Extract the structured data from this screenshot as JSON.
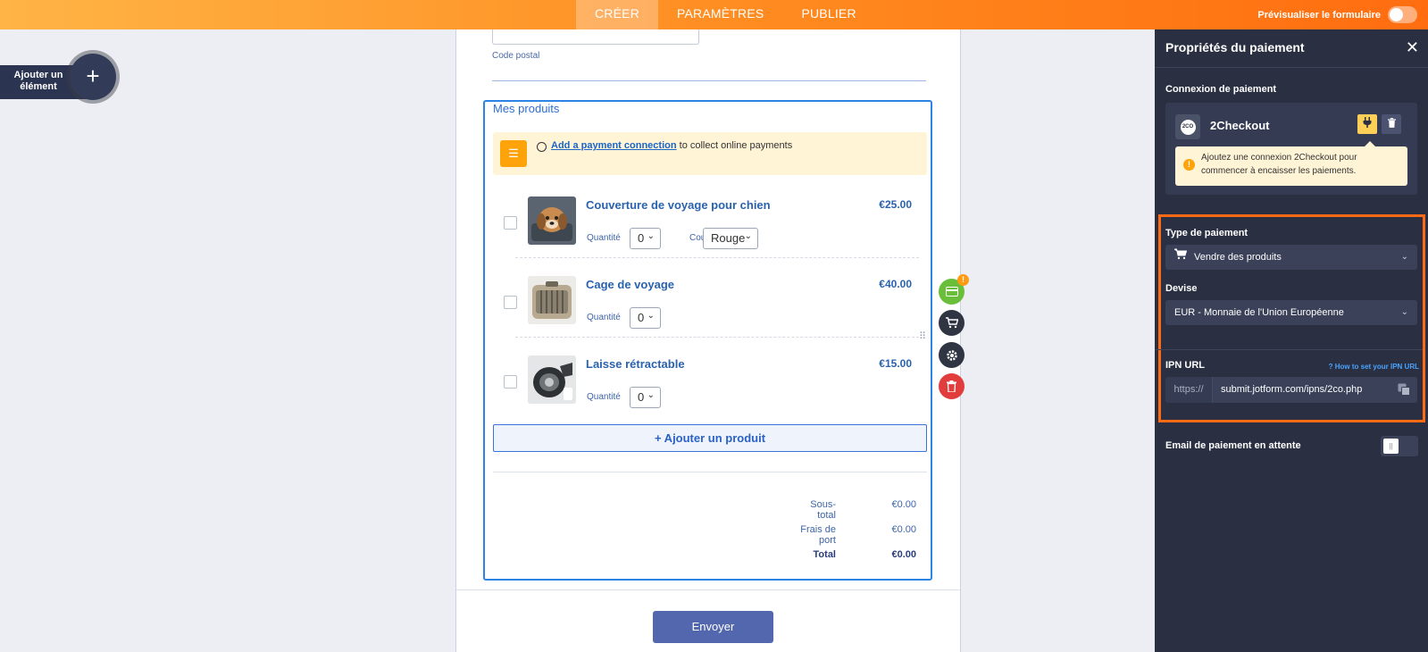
{
  "topbar": {
    "tabs": [
      "CRÉER",
      "PARAMÈTRES",
      "PUBLIER"
    ],
    "preview_label": "Prévisualiser le formulaire"
  },
  "add_element": {
    "label": "Ajouter un élément"
  },
  "form": {
    "zip_label": "Code postal",
    "products_title": "Mes produits",
    "notice_link": "Add a payment connection",
    "notice_text": " to collect online payments",
    "quantity_label": "Quantité",
    "color_label": "Couleur",
    "products": [
      {
        "name": "Couverture de voyage pour chien",
        "price": "€25.00",
        "quantity": "0",
        "color": "Rouge"
      },
      {
        "name": "Cage de voyage",
        "price": "€40.00",
        "quantity": "0"
      },
      {
        "name": "Laisse rétractable",
        "price": "€15.00",
        "quantity": "0"
      }
    ],
    "add_product": "+ Ajouter un produit",
    "totals": [
      {
        "label": "Sous-total",
        "value": "€0.00"
      },
      {
        "label": "Frais de port",
        "value": "€0.00"
      },
      {
        "label": "Total",
        "value": "€0.00"
      }
    ],
    "submit": "Envoyer"
  },
  "tools": {
    "warning_badge": "!"
  },
  "panel": {
    "title": "Propriétés du paiement",
    "connection_label": "Connexion de paiement",
    "gateway_name": "2Checkout",
    "gateway_logo_text": "2CO",
    "connection_warning": "Ajoutez une connexion 2Checkout pour commencer à encaisser les paiements.",
    "payment_type_label": "Type de paiement",
    "payment_type_value": "Vendre des produits",
    "currency_label": "Devise",
    "currency_value": "EUR - Monnaie de l'Union Européenne",
    "ipn_label": "IPN URL",
    "ipn_help": "How to set your IPN URL",
    "ipn_prefix": "https://",
    "ipn_value": "submit.jotform.com/ipns/2co.php",
    "pending_email_label": "Email de paiement en attente"
  },
  "colors": {
    "topbar_start": "#ffb445",
    "topbar_end": "#ff6d10",
    "accent_blue": "#2d83e6",
    "panel_bg": "#2a3042",
    "highlight": "#ff6a14",
    "submit": "#5267ad"
  }
}
